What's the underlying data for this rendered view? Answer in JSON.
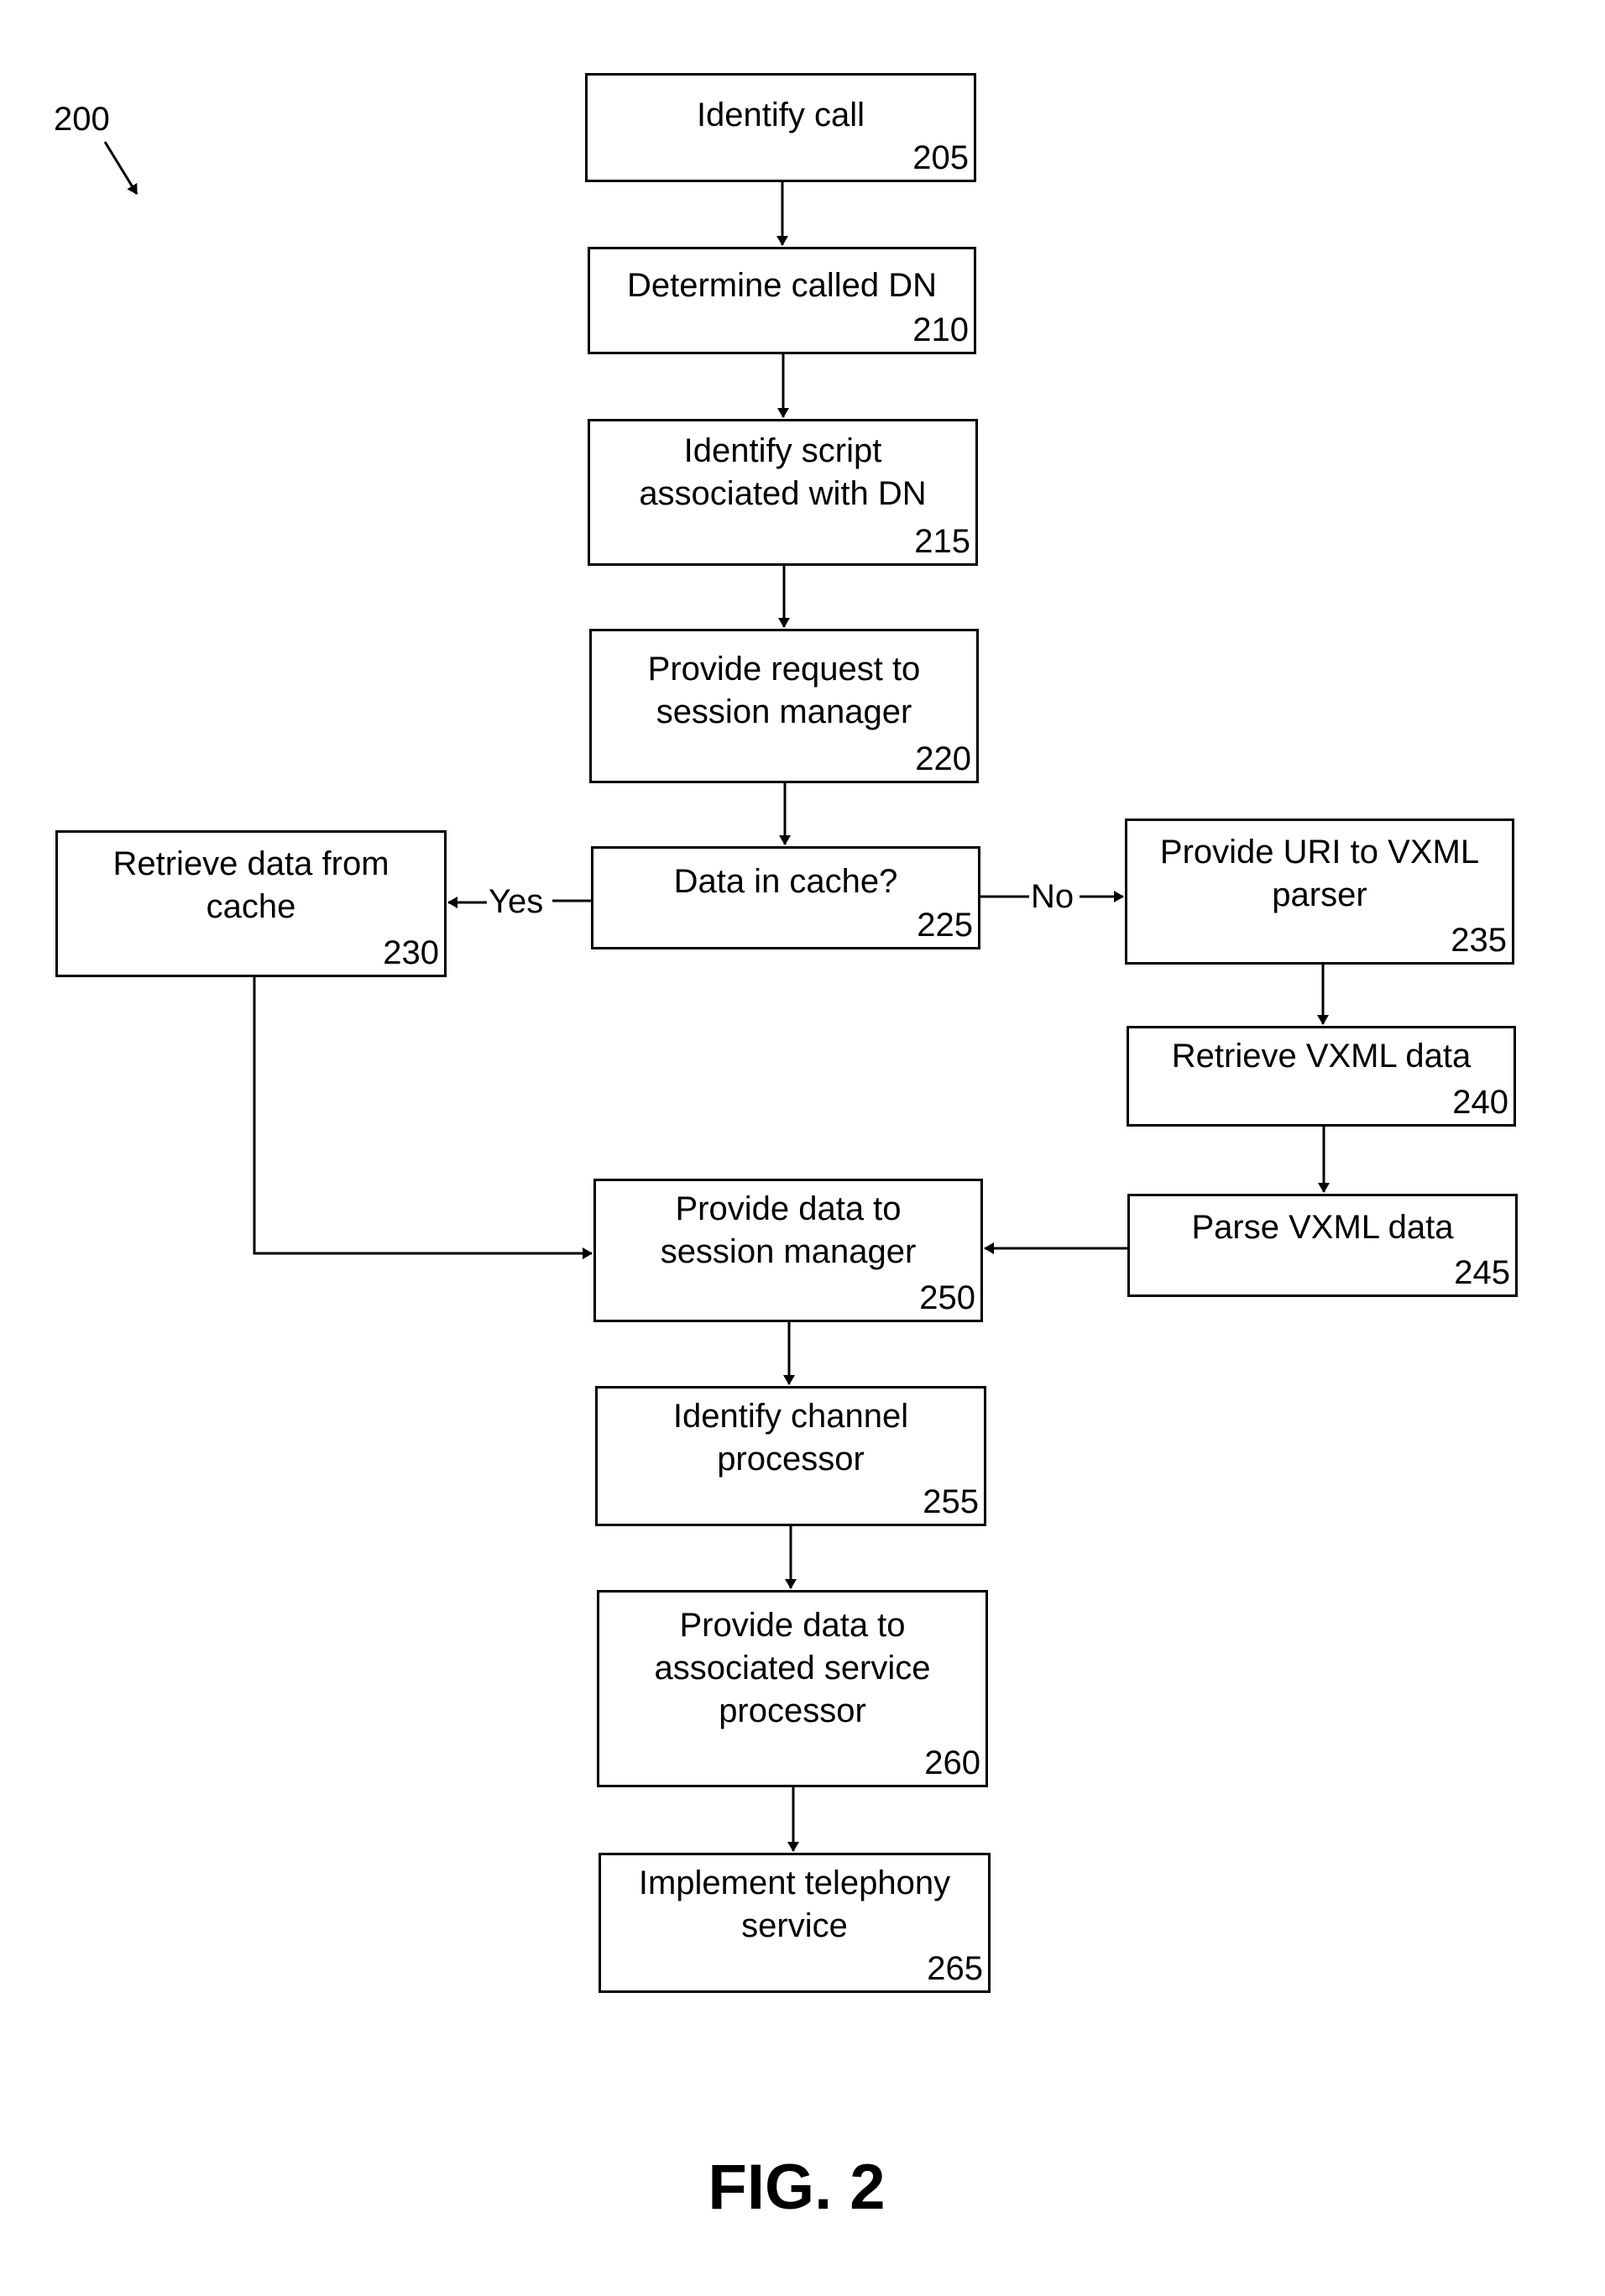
{
  "figure": {
    "reference": "200",
    "title": "FIG. 2"
  },
  "steps": {
    "s205": {
      "text": "Identify call",
      "ref": "205"
    },
    "s210": {
      "text": "Determine called DN",
      "ref": "210"
    },
    "s215": {
      "text": "Identify script\nassociated with DN",
      "ref": "215"
    },
    "s220": {
      "text": "Provide request to\nsession manager",
      "ref": "220"
    },
    "s225": {
      "text": "Data in cache?",
      "ref": "225"
    },
    "s230": {
      "text": "Retrieve data from\ncache",
      "ref": "230"
    },
    "s235": {
      "text": "Provide URI to VXML\nparser",
      "ref": "235"
    },
    "s240": {
      "text": "Retrieve VXML data",
      "ref": "240"
    },
    "s245": {
      "text": "Parse VXML data",
      "ref": "245"
    },
    "s250": {
      "text": "Provide data to\nsession manager",
      "ref": "250"
    },
    "s255": {
      "text": "Identify channel\nprocessor",
      "ref": "255"
    },
    "s260": {
      "text": "Provide data to\nassociated service\nprocessor",
      "ref": "260"
    },
    "s265": {
      "text": "Implement telephony\nservice",
      "ref": "265"
    }
  },
  "edges": {
    "yes": "Yes",
    "no": "No"
  }
}
